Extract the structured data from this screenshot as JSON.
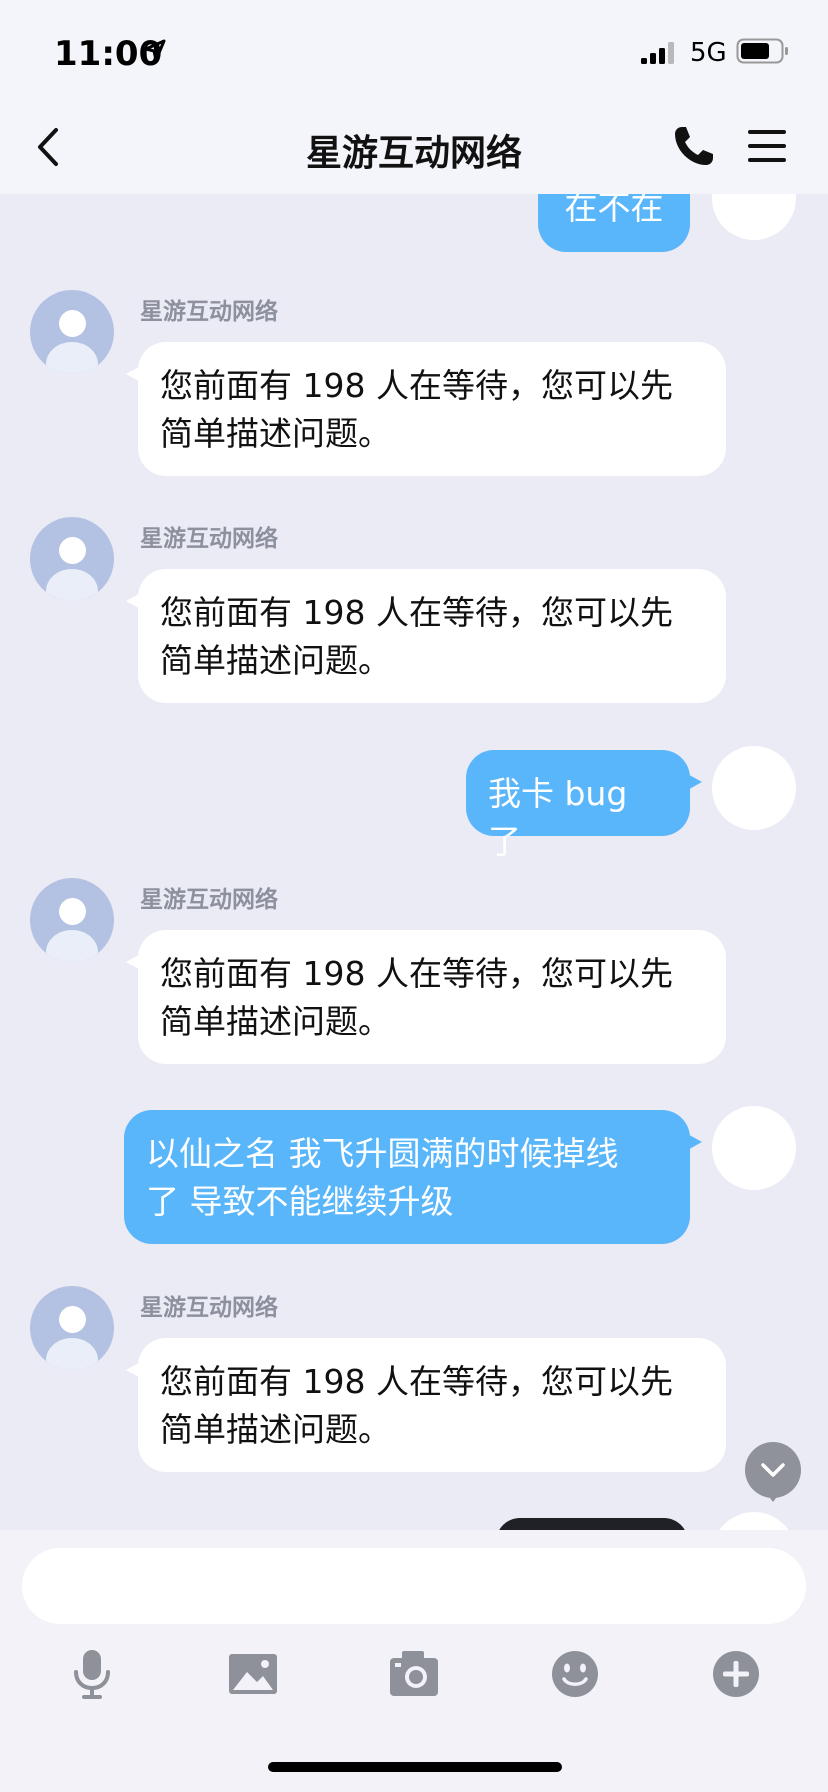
{
  "status": {
    "time": "11:00",
    "network": "5G"
  },
  "header": {
    "title": "星游互动网络"
  },
  "messages": [
    {
      "direction": "out",
      "text": "在不在"
    },
    {
      "direction": "in",
      "sender": "星游互动网络",
      "line1": "您前面有 198 人在等待，您可以先",
      "line2": "简单描述问题。"
    },
    {
      "direction": "in",
      "sender": "星游互动网络",
      "line1": "您前面有 198 人在等待，您可以先",
      "line2": "简单描述问题。"
    },
    {
      "direction": "out",
      "text": "我卡 bug 了"
    },
    {
      "direction": "in",
      "sender": "星游互动网络",
      "line1": "您前面有 198 人在等待，您可以先",
      "line2": "简单描述问题。"
    },
    {
      "direction": "out",
      "line1": "以仙之名 我飞升圆满的时候掉线",
      "line2": "了 导致不能继续升级"
    },
    {
      "direction": "in",
      "sender": "星游互动网络",
      "line1": "您前面有 198 人在等待，您可以先",
      "line2": "简单描述问题。"
    }
  ],
  "input": {
    "placeholder": ""
  },
  "colors": {
    "outgoing_bubble": "#5ab6fa",
    "incoming_bubble": "#ffffff",
    "background": "#ebebf5",
    "avatar": "#b3c1e3"
  },
  "toolbar": [
    "microphone-icon",
    "image-icon",
    "camera-icon",
    "emoji-icon",
    "plus-icon"
  ]
}
